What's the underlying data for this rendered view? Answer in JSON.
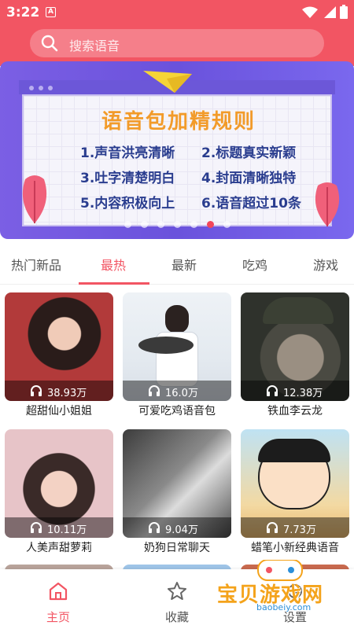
{
  "status": {
    "time": "3:22",
    "a": "A"
  },
  "search": {
    "placeholder": "搜索语音"
  },
  "banner": {
    "title": "语音包加精规则",
    "rules": [
      "1.声音洪亮清晰",
      "2.标题真实新颖",
      "3.吐字清楚明白",
      "4.封面清晰独特",
      "5.内容积极向上",
      "6.语音超过10条"
    ],
    "page_count": 7,
    "active_page": 6
  },
  "tabs": [
    {
      "label": "热门新品",
      "active": false
    },
    {
      "label": "最热",
      "active": true
    },
    {
      "label": "最新",
      "active": false
    },
    {
      "label": "吃鸡",
      "active": false
    },
    {
      "label": "游戏",
      "active": false
    }
  ],
  "items": [
    {
      "name": "超甜仙小姐姐",
      "count": "38.93万"
    },
    {
      "name": "可爱吃鸡语音包",
      "count": "16.0万"
    },
    {
      "name": "铁血李云龙",
      "count": "12.38万"
    },
    {
      "name": "人美声甜萝莉",
      "count": "10.11万"
    },
    {
      "name": "奶狗日常聊天",
      "count": "9.04万"
    },
    {
      "name": "蜡笔小新经典语音",
      "count": "7.73万"
    }
  ],
  "bottom_nav": [
    {
      "label": "主页",
      "icon": "home-icon",
      "active": true
    },
    {
      "label": "收藏",
      "icon": "star-icon",
      "active": false
    },
    {
      "label": "设置",
      "icon": "settings-icon",
      "active": false
    }
  ],
  "watermark": {
    "text": "宝贝游戏网",
    "url": "baobeiy.com"
  },
  "colors": {
    "accent": "#f25563",
    "banner": "#6a52dc",
    "rule_text": "#2a3d8f",
    "title": "#f29b2a"
  }
}
